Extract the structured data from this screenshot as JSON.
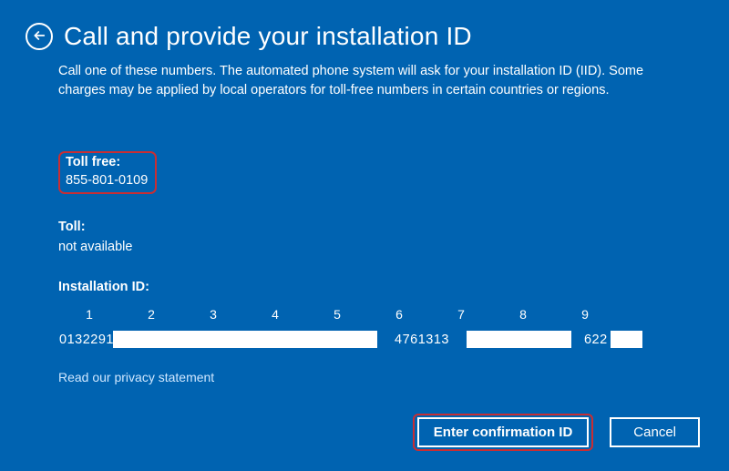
{
  "header": {
    "title": "Call and provide your installation ID"
  },
  "instructions": "Call one of these numbers. The automated phone system will ask for your installation ID (IID). Some charges may be applied by local operators for toll-free numbers in certain countries or regions.",
  "toll_free": {
    "label": "Toll free:",
    "number": "855-801-0109"
  },
  "toll": {
    "label": "Toll:",
    "value": "not available"
  },
  "installation": {
    "label": "Installation ID:",
    "columns": [
      "1",
      "2",
      "3",
      "4",
      "5",
      "6",
      "7",
      "8",
      "9"
    ],
    "seg1": "0132291",
    "seg6": "4761313",
    "seg8": "622"
  },
  "privacy_link": "Read our privacy statement",
  "buttons": {
    "enter_confirmation": "Enter confirmation ID",
    "cancel": "Cancel"
  }
}
